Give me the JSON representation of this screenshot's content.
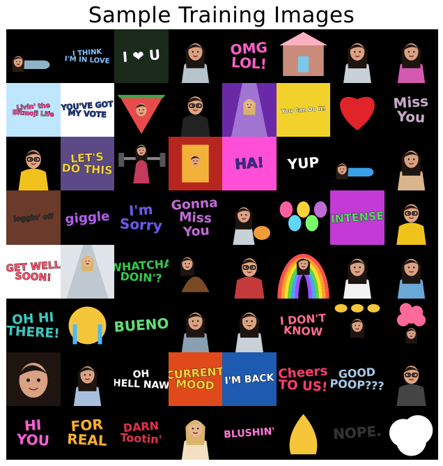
{
  "title": "Sample Training Images",
  "grid": {
    "rows": 8,
    "cols": 8
  },
  "tiles": [
    {
      "kind": "lying",
      "skin": "#d9a283",
      "hair": "#2a1a14",
      "shirt": "#8fb2c8"
    },
    {
      "kind": "text",
      "text": "I THINK\nI'M IN LOVE",
      "fg": "#7fc0ff",
      "bg": "#000000"
    },
    {
      "kind": "text",
      "text": "I ❤ U",
      "fg": "#ffffff",
      "bg": "#1b2a1a"
    },
    {
      "kind": "avatar",
      "skin": "#d9a283",
      "hair": "#1e1410",
      "shirt": "#b7c4cc"
    },
    {
      "kind": "text",
      "text": "OMG\nLOL!",
      "fg": "#ff5ec8",
      "bg": "#000000"
    },
    {
      "kind": "house",
      "color": "#c98b7a"
    },
    {
      "kind": "avatar",
      "skin": "#d9a283",
      "hair": "#1e1410",
      "shirt": "#c8d0d8"
    },
    {
      "kind": "avatar",
      "skin": "#d9a283",
      "hair": "#1e1410",
      "shirt": "#d35ab0"
    },
    {
      "kind": "text",
      "text": "Livin' the\nBitmoji Life",
      "fg": "#ff4fa3",
      "bg": "#bfe6ff"
    },
    {
      "kind": "text",
      "text": "YOU'VE GOT\nMY VOTE",
      "fg": "#1d3b8c",
      "bg": "#ffffff"
    },
    {
      "kind": "melon",
      "color": "#e84b4b"
    },
    {
      "kind": "avatarM",
      "skin": "#e0a682",
      "hair": "#2b1a12",
      "shirt": "#222222"
    },
    {
      "kind": "stage",
      "color": "#6a2aa8"
    },
    {
      "kind": "text",
      "text": "You Can Do It!",
      "fg": "#ffffff",
      "bg": "#f2d22a"
    },
    {
      "kind": "heart",
      "color": "#e0242a"
    },
    {
      "kind": "text",
      "text": "Miss\nYou",
      "fg": "#c8a9c8",
      "bg": "#000000"
    },
    {
      "kind": "avatarM",
      "skin": "#e0a682",
      "hair": "#2b1a12",
      "shirt": "#f2c21c"
    },
    {
      "kind": "text",
      "text": "LET'S\nDO THIS",
      "fg": "#f6d23c",
      "bg": "#5b4a86"
    },
    {
      "kind": "lift",
      "color": "#8a8a8a"
    },
    {
      "kind": "curtain",
      "color": "#b7251f"
    },
    {
      "kind": "text",
      "text": "HA!",
      "fg": "#3a2a8f",
      "bg": "#ff4fd8"
    },
    {
      "kind": "text",
      "text": "YUP",
      "fg": "#ffffff",
      "bg": "#000000"
    },
    {
      "kind": "lying",
      "skin": "#d9a283",
      "hair": "#2a1a14",
      "shirt": "#3aa0e8"
    },
    {
      "kind": "avatar",
      "skin": "#d9a283",
      "hair": "#1e1410",
      "shirt": "#d9b48c"
    },
    {
      "kind": "text",
      "text": "loggin' off",
      "fg": "#333333",
      "bg": "#6a3a2a"
    },
    {
      "kind": "text",
      "text": "giggle",
      "fg": "#b25bf0",
      "bg": "#000000"
    },
    {
      "kind": "text",
      "text": "I'm\nSorry",
      "fg": "#6a58e8",
      "bg": "#000000"
    },
    {
      "kind": "text",
      "text": "Gonna\nMiss\nYou",
      "fg": "#c06ad6",
      "bg": "#000000"
    },
    {
      "kind": "avatarCat",
      "skin": "#d9a283",
      "hair": "#1e1410",
      "shirt": "#f29b3a"
    },
    {
      "kind": "balloons",
      "color": "#ff5fa0"
    },
    {
      "kind": "text",
      "text": "INTENSE",
      "fg": "#5bd66a",
      "bg": "#c43ad6"
    },
    {
      "kind": "avatarM",
      "skin": "#e0a682",
      "hair": "#2b1a12",
      "shirt": "#f2c21c"
    },
    {
      "kind": "text",
      "text": "GET WELL\nSOON!",
      "fg": "#ff4f6a",
      "bg": "#ffffff"
    },
    {
      "kind": "fashion",
      "color": "#bfc8d0"
    },
    {
      "kind": "text",
      "text": "WHATCHA\nDOIN'?",
      "fg": "#34c84a",
      "bg": "#000000"
    },
    {
      "kind": "poop",
      "color": "#7a4a26"
    },
    {
      "kind": "avatarM",
      "skin": "#e0a682",
      "hair": "#2b1a12",
      "shirt": "#c43a3a"
    },
    {
      "kind": "rainbow",
      "color": "#ff4f4f"
    },
    {
      "kind": "avatar",
      "skin": "#d9a283",
      "hair": "#1e1410",
      "shirt": "#f2f2f2"
    },
    {
      "kind": "avatar",
      "skin": "#d9a283",
      "hair": "#1e1410",
      "shirt": "#6aa8d8"
    },
    {
      "kind": "text",
      "text": "OH HI\nTHERE!",
      "fg": "#3ac8c0",
      "bg": "#000000"
    },
    {
      "kind": "cry",
      "color": "#f6c63a"
    },
    {
      "kind": "text",
      "text": "BUENO",
      "fg": "#5ee07a",
      "bg": "#000000"
    },
    {
      "kind": "avatar",
      "skin": "#d9a283",
      "hair": "#1e1410",
      "shirt": "#8aa0b0"
    },
    {
      "kind": "avatar",
      "skin": "#d9a283",
      "hair": "#1e1410",
      "shirt": "#c8d0d8"
    },
    {
      "kind": "text",
      "text": "I DON'T\nKNOW",
      "fg": "#ff6a8a",
      "bg": "#000000"
    },
    {
      "kind": "clap",
      "color": "#f6c63a"
    },
    {
      "kind": "flowers",
      "color": "#ff6a9a"
    },
    {
      "kind": "face",
      "skin": "#d9a283",
      "hair": "#1e1410"
    },
    {
      "kind": "avatar",
      "skin": "#d9a283",
      "hair": "#1e1410",
      "shirt": "#a8c0e0"
    },
    {
      "kind": "text",
      "text": "OH\nHELL NAW",
      "fg": "#ffffff",
      "bg": "#000000"
    },
    {
      "kind": "text",
      "text": "CURRENT\nMOOD",
      "fg": "#ffd23a",
      "bg": "#e04a1a"
    },
    {
      "kind": "text",
      "text": "I'M BACK",
      "fg": "#ffffff",
      "bg": "#1e5ab0"
    },
    {
      "kind": "text",
      "text": "Cheers\nTO US!",
      "fg": "#ff3a6a",
      "bg": "#000000"
    },
    {
      "kind": "text",
      "text": "GOOD\nPOOP???",
      "fg": "#a8c8e8",
      "bg": "#000000"
    },
    {
      "kind": "avatarM",
      "skin": "#e0a682",
      "hair": "#2b1a12",
      "shirt": "#444444"
    },
    {
      "kind": "text",
      "text": "HI\nYOU",
      "fg": "#ff5ed6",
      "bg": "#000000"
    },
    {
      "kind": "text",
      "text": "FOR\nREAL",
      "fg": "#ffb02a",
      "bg": "#000000"
    },
    {
      "kind": "text",
      "text": "DARN\nTootin'",
      "fg": "#e0304a",
      "bg": "#000000"
    },
    {
      "kind": "avatar",
      "skin": "#e8b890",
      "hair": "#d9b46a",
      "shirt": "#f2e0c0"
    },
    {
      "kind": "text",
      "text": "BLUSHIN'",
      "fg": "#ff7ad6",
      "bg": "#000000"
    },
    {
      "kind": "pray",
      "color": "#f6c63a"
    },
    {
      "kind": "text",
      "text": "NOPE.",
      "fg": "#333333",
      "bg": "#000000"
    },
    {
      "kind": "cloud",
      "color": "#ffffff"
    }
  ]
}
